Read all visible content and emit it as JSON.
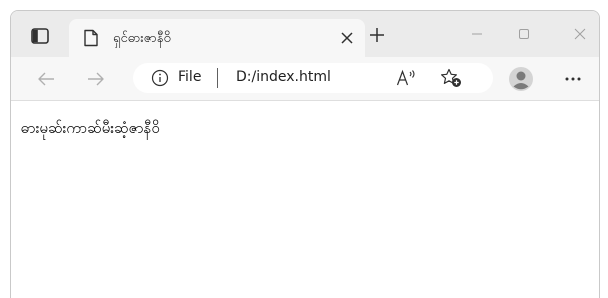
{
  "tab": {
    "title": "ရှင်ဓားဇာနီဝိ"
  },
  "address": {
    "scheme_label": "File",
    "url": "D:/index.html"
  },
  "page": {
    "text": "ဓားမုဆ်းကာဆ်မီးဆံ့ဇာနီဝိ"
  },
  "icons": {
    "tab_actions": "tab-actions-icon",
    "page": "page-icon",
    "close_tab": "close-icon",
    "new_tab": "plus-icon",
    "minimize": "minimize-icon",
    "maximize": "maximize-icon",
    "close_window": "close-icon",
    "back": "arrow-left-icon",
    "forward": "arrow-right-icon",
    "info": "info-icon",
    "read_aloud": "read-aloud-icon",
    "favorite": "star-add-icon",
    "profile": "profile-icon",
    "more": "more-icon"
  },
  "colors": {
    "titlebar": "#ebebeb",
    "toolbar": "#f7f7f7",
    "address_bg": "#ffffff",
    "disabled_icon": "#b0b0b0",
    "icon": "#303030"
  }
}
